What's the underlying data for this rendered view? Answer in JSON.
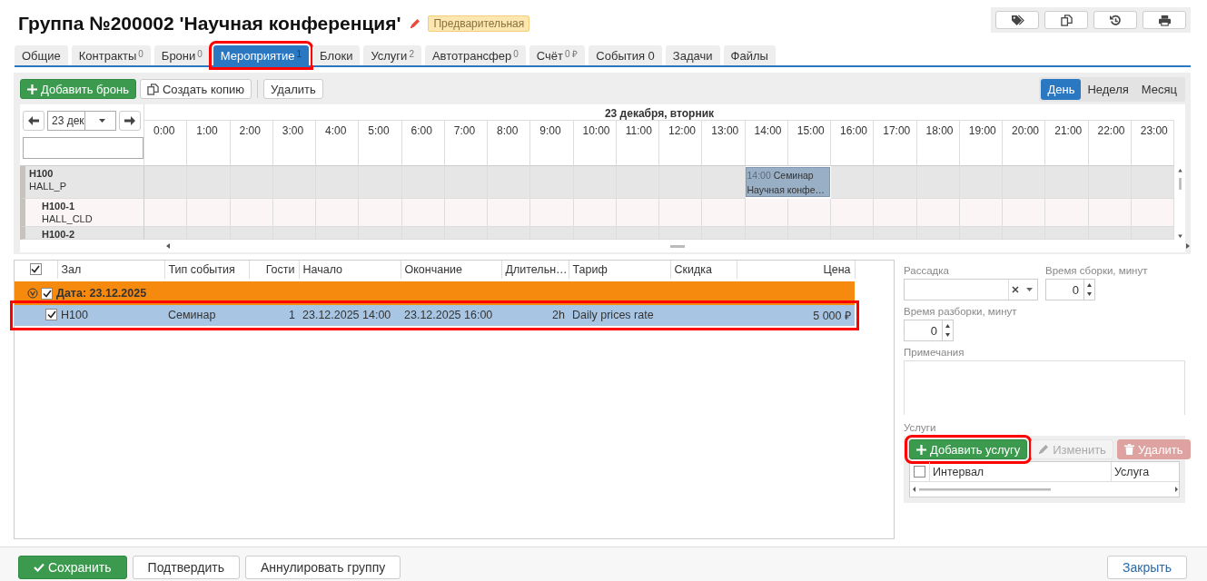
{
  "title": "Группа №200002 'Научная конференция'",
  "status_badge": "Предварительная",
  "tabs": [
    {
      "label": "Общие",
      "selected": false,
      "highlighted": false
    },
    {
      "label": "Контракты",
      "count": "0",
      "selected": false,
      "highlighted": false
    },
    {
      "label": "Брони",
      "count": "0",
      "selected": false,
      "highlighted": false
    },
    {
      "label": "Мероприятие",
      "count": "1",
      "selected": true,
      "highlighted": true
    },
    {
      "label": "Блоки",
      "selected": false,
      "highlighted": false
    },
    {
      "label": "Услуги",
      "count": "2",
      "selected": false,
      "highlighted": false
    },
    {
      "label": "Автотрансфер",
      "count": "0",
      "selected": false,
      "highlighted": false
    },
    {
      "label": "Счёт",
      "count": "0 ₽",
      "selected": false,
      "highlighted": false
    },
    {
      "label": "События 0",
      "selected": false,
      "highlighted": false
    },
    {
      "label": "Задачи",
      "selected": false,
      "highlighted": false
    },
    {
      "label": "Файлы",
      "selected": false,
      "highlighted": false
    }
  ],
  "actions": [
    {
      "label": "Добавить бронь",
      "kind": "add"
    },
    {
      "label": "Создать копию",
      "kind": "copy"
    },
    {
      "label": "Удалить",
      "kind": "plain"
    }
  ],
  "views": [
    {
      "label": "День",
      "selected": true
    },
    {
      "label": "Неделя",
      "selected": false
    },
    {
      "label": "Месяц",
      "selected": false
    }
  ],
  "scheduler": {
    "date_value": "23 дек",
    "day_title": "23 декабря, вторник",
    "hours": [
      "0:00",
      "1:00",
      "2:00",
      "3:00",
      "4:00",
      "5:00",
      "6:00",
      "7:00",
      "8:00",
      "9:00",
      "10:00",
      "11:00",
      "12:00",
      "13:00",
      "14:00",
      "15:00",
      "16:00",
      "17:00",
      "18:00",
      "19:00",
      "20:00",
      "21:00",
      "22:00",
      "23:00"
    ],
    "rooms": [
      {
        "code": "H100",
        "type": "HALL_P",
        "children": [
          {
            "code": "H100-1",
            "type": "HALL_CLD"
          },
          {
            "code": "H100-2"
          }
        ]
      }
    ],
    "event": {
      "time": "14:00",
      "title": "Семинар",
      "subtitle": "Научная конфе…"
    }
  },
  "bookings": {
    "select_all_checked": true,
    "columns": [
      "Зал",
      "Тип события",
      "Гости",
      "Начало",
      "Окончание",
      "Длительн…",
      "Тариф",
      "Скидка",
      "Цена"
    ],
    "groups": [
      {
        "label": "Дата: 23.12.2025",
        "checked": true,
        "expanded": true,
        "rows": [
          {
            "checked": true,
            "selected": true,
            "highlighted": true,
            "cells": [
              "H100",
              "Семинар",
              "1",
              "23.12.2025 14:00",
              "23.12.2025 16:00",
              "2h",
              "Daily prices rate",
              "",
              "5 000 ₽"
            ]
          }
        ]
      }
    ]
  },
  "details": {
    "seating": {
      "label": "Рассадка"
    },
    "setup_time": {
      "label": "Время сборки, минут",
      "value": "0"
    },
    "teardown_time": {
      "label": "Время разборки, минут",
      "value": "0"
    },
    "notes": {
      "label": "Примечания"
    },
    "services": {
      "label": "Услуги",
      "buttons": [
        {
          "label": "Добавить услугу",
          "kind": "add",
          "disabled": false,
          "highlighted": true
        },
        {
          "label": "Изменить",
          "kind": "edit",
          "disabled": true,
          "highlighted": false
        },
        {
          "label": "Удалить",
          "kind": "delete",
          "disabled": true,
          "highlighted": false
        }
      ],
      "select_all_checked": false,
      "columns": [
        "Интервал",
        "Услуга"
      ]
    }
  },
  "footer": {
    "buttons": [
      {
        "label": "Сохранить",
        "kind": "primary"
      },
      {
        "label": "Подтвердить",
        "kind": "plain"
      },
      {
        "label": "Аннулировать группу",
        "kind": "plain"
      }
    ],
    "close": "Закрыть"
  }
}
